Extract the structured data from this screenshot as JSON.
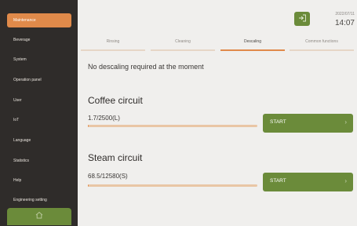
{
  "sidebar": {
    "items": [
      {
        "label": "Maintenance",
        "active": true
      },
      {
        "label": "Beverage",
        "active": false
      },
      {
        "label": "System",
        "active": false
      },
      {
        "label": "Operation panel",
        "active": false
      },
      {
        "label": "User",
        "active": false
      },
      {
        "label": "IoT",
        "active": false
      },
      {
        "label": "Language",
        "active": false
      },
      {
        "label": "Statistics",
        "active": false
      },
      {
        "label": "Help",
        "active": false
      },
      {
        "label": "Engineering setting",
        "active": false
      }
    ],
    "home_icon": "home-icon"
  },
  "header": {
    "date": "2022/07/11",
    "time": "14:07",
    "logout_icon": "logout-icon"
  },
  "tabs": [
    {
      "label": "Rinsing",
      "active": false
    },
    {
      "label": "Cleaning",
      "active": false
    },
    {
      "label": "Descaling",
      "active": true
    },
    {
      "label": "Common functions",
      "active": false
    }
  ],
  "main": {
    "notice": "No descaling required at the moment",
    "coffee": {
      "title": "Coffee circuit",
      "value": "1.7/2500(L)",
      "progress": 0.0007,
      "button_label": "START"
    },
    "steam": {
      "title": "Steam circuit",
      "value": "68.5/12580(S)",
      "progress": 0.0054,
      "button_label": "START"
    }
  },
  "colors": {
    "accent_orange": "#e08a4a",
    "accent_green": "#6b8b3a",
    "sidebar_bg": "#2f2c2a",
    "main_bg": "#f0efed"
  }
}
